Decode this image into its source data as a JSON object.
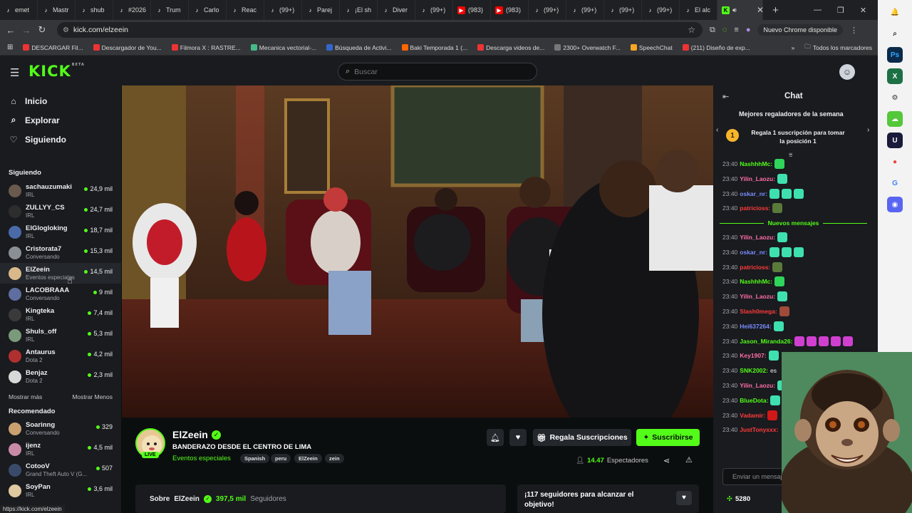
{
  "browser": {
    "tabs": [
      {
        "label": "emet",
        "color": "#ffffff"
      },
      {
        "label": "Mastr",
        "color": "#ffffff"
      },
      {
        "label": "shub",
        "color": "#ffffff"
      },
      {
        "label": "#2026",
        "color": "#ffffff"
      },
      {
        "label": "Trum",
        "color": "#ffffff"
      },
      {
        "label": "Carlo",
        "color": "#ffffff"
      },
      {
        "label": "Reac",
        "color": "#ffffff"
      },
      {
        "label": "(99+)",
        "color": "#ffffff"
      },
      {
        "label": "Parej",
        "color": "#ffffff"
      },
      {
        "label": "¡El sh",
        "color": "#ffffff"
      },
      {
        "label": "Diver",
        "color": "#ffffff"
      },
      {
        "label": "(99+)",
        "color": "#ffffff"
      },
      {
        "label": "(983)",
        "color": "#ff0000"
      },
      {
        "label": "(983)",
        "color": "#ff0000"
      },
      {
        "label": "(99+)",
        "color": "#ffffff"
      },
      {
        "label": "(99+)",
        "color": "#ffffff"
      },
      {
        "label": "(99+)",
        "color": "#ffffff"
      },
      {
        "label": "(99+)",
        "color": "#ffffff"
      },
      {
        "label": "El alc",
        "color": "#ffffff"
      }
    ],
    "active_tab_icon": "K",
    "url": "kick.com/elzeein",
    "new_chrome_label": "Nuevo Chrome disponible",
    "bookmarks": [
      {
        "label": "DESCARGAR Fil...",
        "color": "#e33"
      },
      {
        "label": "Descargador de You...",
        "color": "#e33"
      },
      {
        "label": "Filmora X : RASTRE...",
        "color": "#e33"
      },
      {
        "label": "Mecanica vectorial-...",
        "color": "#4b8"
      },
      {
        "label": "Búsqueda de Activi...",
        "color": "#36c"
      },
      {
        "label": "Baki Temporada 1 (...",
        "color": "#f60"
      },
      {
        "label": "Descarga videos de...",
        "color": "#e33"
      },
      {
        "label": "2300+ Overwatch F...",
        "color": "#777"
      },
      {
        "label": "SpeechChat",
        "color": "#f5a623"
      },
      {
        "label": "(211) Diseño de exp...",
        "color": "#e33"
      }
    ],
    "all_bookmarks_label": "Todos los marcadores",
    "status_url": "https://kick.com/elzeein"
  },
  "kick": {
    "logo": "KICK",
    "logo_beta": "BETA",
    "search_placeholder": "Buscar"
  },
  "leftnav": {
    "main": [
      {
        "label": "Inicio",
        "icon": "⌂"
      },
      {
        "label": "Explorar",
        "icon": "⌕"
      },
      {
        "label": "Siguiendo",
        "icon": "♡"
      }
    ],
    "following_title": "Siguiendo",
    "following": [
      {
        "name": "sachauzumaki",
        "category": "IRL",
        "viewers": "24,9 mil",
        "color": "#6a5a4e"
      },
      {
        "name": "ZULLYY_CS",
        "category": "IRL",
        "viewers": "24,7 mil",
        "color": "#2d2d2d"
      },
      {
        "name": "ElGlogloking",
        "category": "IRL",
        "viewers": "18,7 mil",
        "color": "#4a6aa8"
      },
      {
        "name": "Cristorata7",
        "category": "Conversando",
        "viewers": "15,3 mil",
        "color": "#8a8f96"
      },
      {
        "name": "ElZeein",
        "category": "Eventos especiales",
        "viewers": "14,5 mil",
        "color": "#d9b98a"
      },
      {
        "name": "LACOBRAAA",
        "category": "Conversando",
        "viewers": "9 mil",
        "color": "#5e6ea0"
      },
      {
        "name": "Kingteka",
        "category": "IRL",
        "viewers": "7,4 mil",
        "color": "#3a3a3a"
      },
      {
        "name": "Shuls_off",
        "category": "IRL",
        "viewers": "5,3 mil",
        "color": "#7a9a7a"
      },
      {
        "name": "Antaurus",
        "category": "Dota 2",
        "viewers": "4,2 mil",
        "color": "#b03030"
      },
      {
        "name": "Benjaz",
        "category": "Dota 2",
        "viewers": "2,3 mil",
        "color": "#d8d8d8"
      }
    ],
    "show_more": "Mostrar más",
    "show_less": "Mostrar Menos",
    "recommended_title": "Recomendado",
    "recommended": [
      {
        "name": "Soarinng",
        "category": "Conversando",
        "viewers": "329",
        "color": "#caa070"
      },
      {
        "name": "ijenz",
        "category": "IRL",
        "viewers": "4,5 mil",
        "color": "#c98aa8"
      },
      {
        "name": "CotooV",
        "category": "Grand Theft Auto V (G...",
        "viewers": "507",
        "color": "#3a4a6a"
      },
      {
        "name": "SoyPan",
        "category": "IRL",
        "viewers": "3,6 mil",
        "color": "#e0c8a0"
      }
    ]
  },
  "stream": {
    "name": "ElZeein",
    "live": "LIVE",
    "title": "BANDERAZO DESDE EL CENTRO DE LIMA",
    "category": "Eventos especiales",
    "tags": [
      "Spanish",
      "peru",
      "ElZeein",
      "zein"
    ],
    "gift_label": "Regala Suscripciones",
    "subscribe_label": "Suscribirse",
    "viewers": "14.4‍7",
    "viewers_label": "Espectadores",
    "about_prefix": "Sobre",
    "about_name": "ElZeein",
    "followers": "397,5 mil",
    "followers_label": "Seguidores",
    "goal_text": "¡117 seguidores para alcanzar el objetivo!"
  },
  "chat": {
    "title": "Chat",
    "top_gifters_title": "Mejores regaladores de la semana",
    "top_gift_rank": "1",
    "top_gift_text": "Regala 1 suscripción para tomar la posición 1",
    "new_messages_label": "Nuevos mensajes",
    "messages_before": [
      {
        "time": "23:40",
        "user": "NashhhMc:",
        "color": "#53fc18",
        "emotes": [
          "#2fd45a"
        ]
      },
      {
        "time": "23:40",
        "user": "Yilin_Laozu:",
        "color": "#ff6ea8",
        "emotes": [
          "#3fe0b0"
        ]
      },
      {
        "time": "23:40",
        "user": "oskar_nr:",
        "color": "#7a8cff",
        "emotes": [
          "#3fe0b0",
          "#3fe0b0",
          "#3fe0b0"
        ]
      },
      {
        "time": "23:40",
        "user": "patricioss:",
        "color": "#ff3b3b",
        "emotes": [
          "#5a7a3a"
        ]
      }
    ],
    "messages_after": [
      {
        "time": "23:40",
        "user": "Yilin_Laozu:",
        "color": "#ff6ea8",
        "text": "",
        "emotes": [
          "#3fe0b0"
        ]
      },
      {
        "time": "23:40",
        "user": "oskar_nr:",
        "color": "#7a8cff",
        "text": "",
        "emotes": [
          "#3fe0b0",
          "#3fe0b0",
          "#3fe0b0"
        ]
      },
      {
        "time": "23:40",
        "user": "patricioss:",
        "color": "#ff3b3b",
        "text": "",
        "emotes": [
          "#5a7a3a"
        ]
      },
      {
        "time": "23:40",
        "user": "NashhhMc:",
        "color": "#53fc18",
        "text": "",
        "emotes": [
          "#2fd45a"
        ]
      },
      {
        "time": "23:40",
        "user": "Yilin_Laozu:",
        "color": "#ff6ea8",
        "text": "",
        "emotes": [
          "#3fe0b0"
        ]
      },
      {
        "time": "23:40",
        "user": "Slash0mega:",
        "color": "#ff3b3b",
        "text": "",
        "emotes": [
          "#a04a3a"
        ]
      },
      {
        "time": "23:40",
        "user": "Hei637264:",
        "color": "#7a8cff",
        "text": "",
        "emotes": [
          "#3fe0b0"
        ]
      },
      {
        "time": "23:40",
        "user": "Jason_Miranda26:",
        "color": "#53fc18",
        "text": "",
        "emotes": [
          "#d040d0",
          "#d040d0",
          "#d040d0",
          "#d040d0",
          "#d040d0"
        ]
      },
      {
        "time": "23:40",
        "user": "Key1907:",
        "color": "#ff6ea8",
        "text": "",
        "emotes": [
          "#3fe0b0"
        ]
      },
      {
        "time": "23:40",
        "user": "SNK2002:",
        "color": "#53fc18",
        "text": "es",
        "emotes": []
      },
      {
        "time": "23:40",
        "user": "Yilin_Laozu:",
        "color": "#ff6ea8",
        "text": "",
        "emotes": [
          "#3fe0b0"
        ]
      },
      {
        "time": "23:40",
        "user": "BlueDota:",
        "color": "#53fc18",
        "text": "",
        "emotes": [
          "#3fe0b0"
        ]
      },
      {
        "time": "23:40",
        "user": "Vadamir:",
        "color": "#ff3b3b",
        "text": "",
        "emotes": [
          "#d01818"
        ]
      },
      {
        "time": "23:40",
        "user": "JustTonyxxx:",
        "color": "#ff3b3b",
        "text": "",
        "emotes": []
      }
    ],
    "input_placeholder": "Enviar un mensaje",
    "points": "5280"
  },
  "windows_sidebar": [
    {
      "icon": "bell-icon",
      "glyph": "🔔",
      "bg": "#f3f3f3",
      "fg": "#333"
    },
    {
      "icon": "search-icon",
      "glyph": "⌕",
      "bg": "#f3f3f3",
      "fg": "#333"
    },
    {
      "icon": "photoshop-icon",
      "glyph": "Ps",
      "bg": "#0b2a4a",
      "fg": "#31a8ff"
    },
    {
      "icon": "excel-icon",
      "glyph": "X",
      "bg": "#1d7044",
      "fg": "#fff"
    },
    {
      "icon": "gear-icon",
      "glyph": "⚙",
      "bg": "#f3f3f3",
      "fg": "#333"
    },
    {
      "icon": "cloud-icon",
      "glyph": "☁",
      "bg": "#54c73b",
      "fg": "#fff"
    },
    {
      "icon": "u-app-icon",
      "glyph": "U",
      "bg": "#1a1a3a",
      "fg": "#fff"
    },
    {
      "icon": "chrome-icon",
      "glyph": "●",
      "bg": "#f3f3f3",
      "fg": "#e8453c"
    },
    {
      "icon": "google-icon",
      "glyph": "G",
      "bg": "#f3f3f3",
      "fg": "#4285f4"
    },
    {
      "icon": "discord-icon",
      "glyph": "◉",
      "bg": "#5865f2",
      "fg": "#fff"
    }
  ]
}
